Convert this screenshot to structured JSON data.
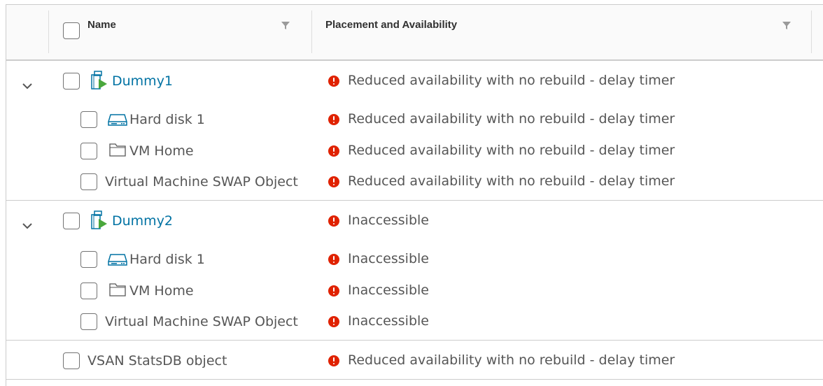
{
  "columns": {
    "name": "Name",
    "placement": "Placement and Availability"
  },
  "groups": [
    {
      "name": "Dummy1",
      "status": "Reduced availability with no rebuild - delay timer",
      "children": [
        {
          "name": "Hard disk 1",
          "icon": "hard-disk-icon",
          "status": "Reduced availability with no rebuild - delay timer"
        },
        {
          "name": "VM Home",
          "icon": "folder-icon",
          "status": "Reduced availability with no rebuild - delay timer"
        },
        {
          "name": "Virtual Machine SWAP Object",
          "icon": "",
          "status": "Reduced availability with no rebuild - delay timer"
        }
      ]
    },
    {
      "name": "Dummy2",
      "status": "Inaccessible",
      "children": [
        {
          "name": "Hard disk 1",
          "icon": "hard-disk-icon",
          "status": "Inaccessible"
        },
        {
          "name": "VM Home",
          "icon": "folder-icon",
          "status": "Inaccessible"
        },
        {
          "name": "Virtual Machine SWAP Object",
          "icon": "",
          "status": "Inaccessible"
        }
      ]
    }
  ],
  "standalone": [
    {
      "name": "VSAN StatsDB object",
      "status": "Reduced availability with no rebuild - delay timer"
    }
  ],
  "colors": {
    "link": "#0072a3",
    "error": "#e02200",
    "vm_icon_green": "#4aa73c",
    "vm_icon_blue": "#0072a3"
  }
}
